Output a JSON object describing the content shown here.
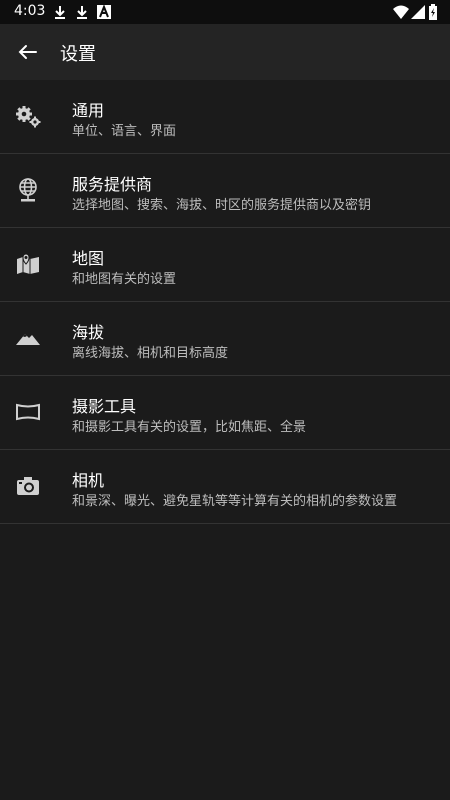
{
  "status_bar": {
    "time": "4:03",
    "icons": [
      "download-icon",
      "download-icon",
      "a-icon",
      "wifi-icon",
      "signal-icon",
      "battery-icon"
    ]
  },
  "app_bar": {
    "title": "设置",
    "back_icon": "arrow-left-icon"
  },
  "settings": {
    "items": [
      {
        "icon": "gears-icon",
        "title": "通用",
        "subtitle": "单位、语言、界面"
      },
      {
        "icon": "globe-icon",
        "title": "服务提供商",
        "subtitle": "选择地图、搜索、海拔、时区的服务提供商以及密钥"
      },
      {
        "icon": "map-icon",
        "title": "地图",
        "subtitle": "和地图有关的设置"
      },
      {
        "icon": "mountain-icon",
        "title": "海拔",
        "subtitle": "离线海拔、相机和目标高度"
      },
      {
        "icon": "frame-icon",
        "title": "摄影工具",
        "subtitle": "和摄影工具有关的设置，比如焦距、全景"
      },
      {
        "icon": "camera-icon",
        "title": "相机",
        "subtitle": "和景深、曝光、避免星轨等等计算有关的相机的参数设置"
      }
    ]
  },
  "colors": {
    "background": "#1b1b1b",
    "app_bar": "#242424",
    "status_bar": "#0e0e0e",
    "divider": "#333333",
    "subtitle": "#bdbdbd"
  }
}
